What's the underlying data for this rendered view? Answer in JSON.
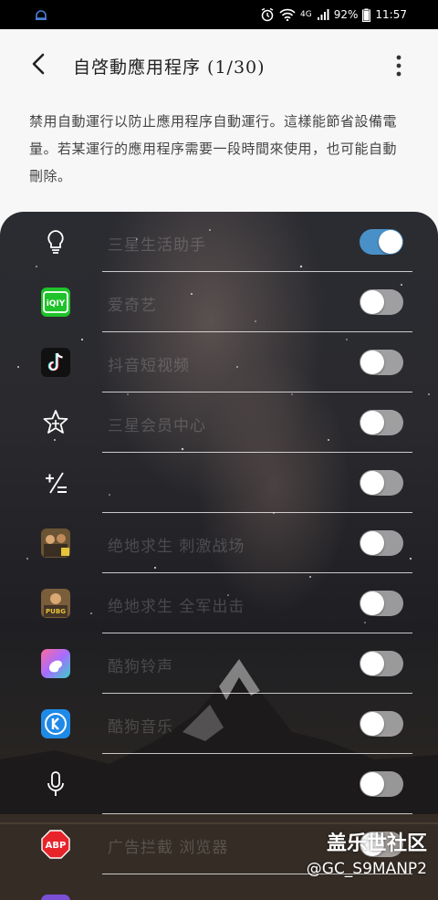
{
  "status_bar": {
    "battery": "92%",
    "time": "11:57",
    "network": "4G"
  },
  "header": {
    "title": "自啓動應用程序 (1/30)"
  },
  "description": "禁用自動運行以防止應用程序自動運行。這樣能節省設備電量。若某運行的應用程序需要一段時間來使用，也可能自動刪除。",
  "apps": [
    {
      "icon": "lightbulb-icon",
      "label": "三星生活助手",
      "enabled": true
    },
    {
      "icon": "iqiyi-icon",
      "label": "爱奇艺",
      "enabled": false
    },
    {
      "icon": "tiktok-icon",
      "label": "抖音短视频",
      "enabled": false
    },
    {
      "icon": "star-add-icon",
      "label": "三星会员中心",
      "enabled": false
    },
    {
      "icon": "calculator-icon",
      "label": "",
      "enabled": false
    },
    {
      "icon": "pubg-icon",
      "label": "绝地求生 刺激战场",
      "enabled": false
    },
    {
      "icon": "pubg-icon-2",
      "label": "绝地求生 全军出击",
      "enabled": false
    },
    {
      "icon": "paint-icon",
      "label": "酷狗铃声",
      "enabled": false
    },
    {
      "icon": "kugou-icon",
      "label": "酷狗音乐",
      "enabled": false
    },
    {
      "icon": "microphone-icon",
      "label": "",
      "enabled": false
    },
    {
      "icon": "adblock-icon",
      "label": "广告拦截 浏览器",
      "enabled": false
    }
  ],
  "watermark": {
    "line1": "盖乐世社区",
    "line2": "@GC_S9MANP2"
  },
  "colors": {
    "toggle_on": "#4a90c8",
    "background": "#f7f7f7"
  }
}
